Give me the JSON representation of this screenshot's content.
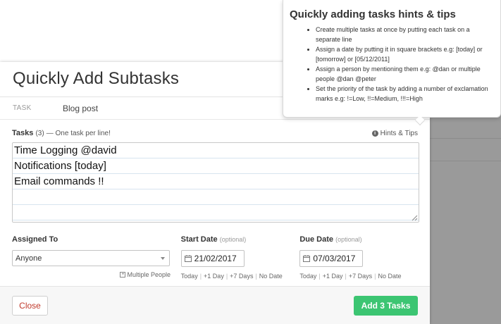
{
  "modal": {
    "title": "Quickly Add Subtasks",
    "task_label": "TASK",
    "task_value": "Blog post"
  },
  "tasks": {
    "label": "Tasks",
    "count": "(3)",
    "hint": "— One task per line!",
    "hints_link": "Hints & Tips",
    "lines": [
      "Time Logging @david",
      "Notifications [today]",
      "Email commands !!",
      "",
      ""
    ]
  },
  "assigned": {
    "label": "Assigned To",
    "value": "Anyone",
    "multiple": "Multiple People"
  },
  "start_date": {
    "label": "Start Date",
    "optional": "(optional)",
    "value": "21/02/2017",
    "links": [
      "Today",
      "+1 Day",
      "+7 Days",
      "No Date"
    ]
  },
  "due_date": {
    "label": "Due Date",
    "optional": "(optional)",
    "value": "07/03/2017",
    "links": [
      "Today",
      "+1 Day",
      "+7 Days",
      "No Date"
    ]
  },
  "footer": {
    "close_label": "Close",
    "add_label": "Add 3 Tasks"
  },
  "popover": {
    "title": "Quickly adding tasks hints & tips",
    "tips": [
      "Create multiple tasks at once by putting each task on a separate line",
      "Assign a date by putting it in square brackets e.g: [today] or [tomorrow] or [05/12/2011]",
      "Assign a person by mentioning them e.g: @dan or multiple people @dan @peter",
      "Set the priority of the task by adding a number of exclamation marks e.g: !=Low, !!=Medium, !!!=High"
    ]
  },
  "colors": {
    "add_button": "#3cc572",
    "close_text": "#c0392b",
    "backdrop": "#9a9a9a"
  }
}
